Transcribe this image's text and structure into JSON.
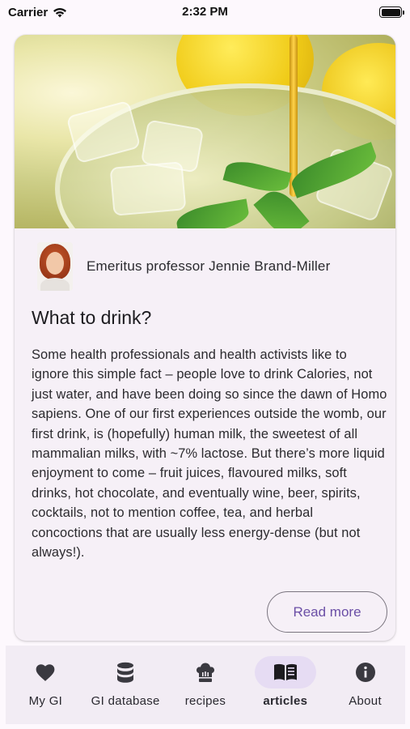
{
  "status_bar": {
    "carrier": "Carrier",
    "time": "2:32 PM",
    "battery_level": 1.0
  },
  "article": {
    "hero_image": "lemonade-honey-mint-photo",
    "author": "Emeritus professor Jennie Brand-Miller",
    "title": "What to drink?",
    "body": "Some health professionals and health activists like to ignore this simple fact – people love to drink Calories, not just water, and have been doing so since the dawn of Homo sapiens. One of our first experiences outside the womb, our first drink, is (hopefully) human milk, the sweetest of all mammalian milks, with ~7% lactose. But there’s more liquid enjoyment to come – fruit juices, flavoured milks, soft drinks, hot chocolate, and eventually wine, beer, spirits, cocktails, not to mention coffee, tea, and herbal concoctions that are usually less energy-dense (but not always!).",
    "read_more_label": "Read more"
  },
  "tabs": [
    {
      "label": "My GI",
      "icon": "heart-icon",
      "active": false
    },
    {
      "label": "GI database",
      "icon": "database-icon",
      "active": false
    },
    {
      "label": "recipes",
      "icon": "chef-hat-icon",
      "active": false
    },
    {
      "label": "articles",
      "icon": "book-open-icon",
      "active": true
    },
    {
      "label": "About",
      "icon": "info-icon",
      "active": false
    }
  ],
  "colors": {
    "accent": "#6b4fa6",
    "active_tab_pill": "#e6dcf3",
    "card_background": "#f6f0f7",
    "tab_bar_background": "#f2ecf4"
  }
}
